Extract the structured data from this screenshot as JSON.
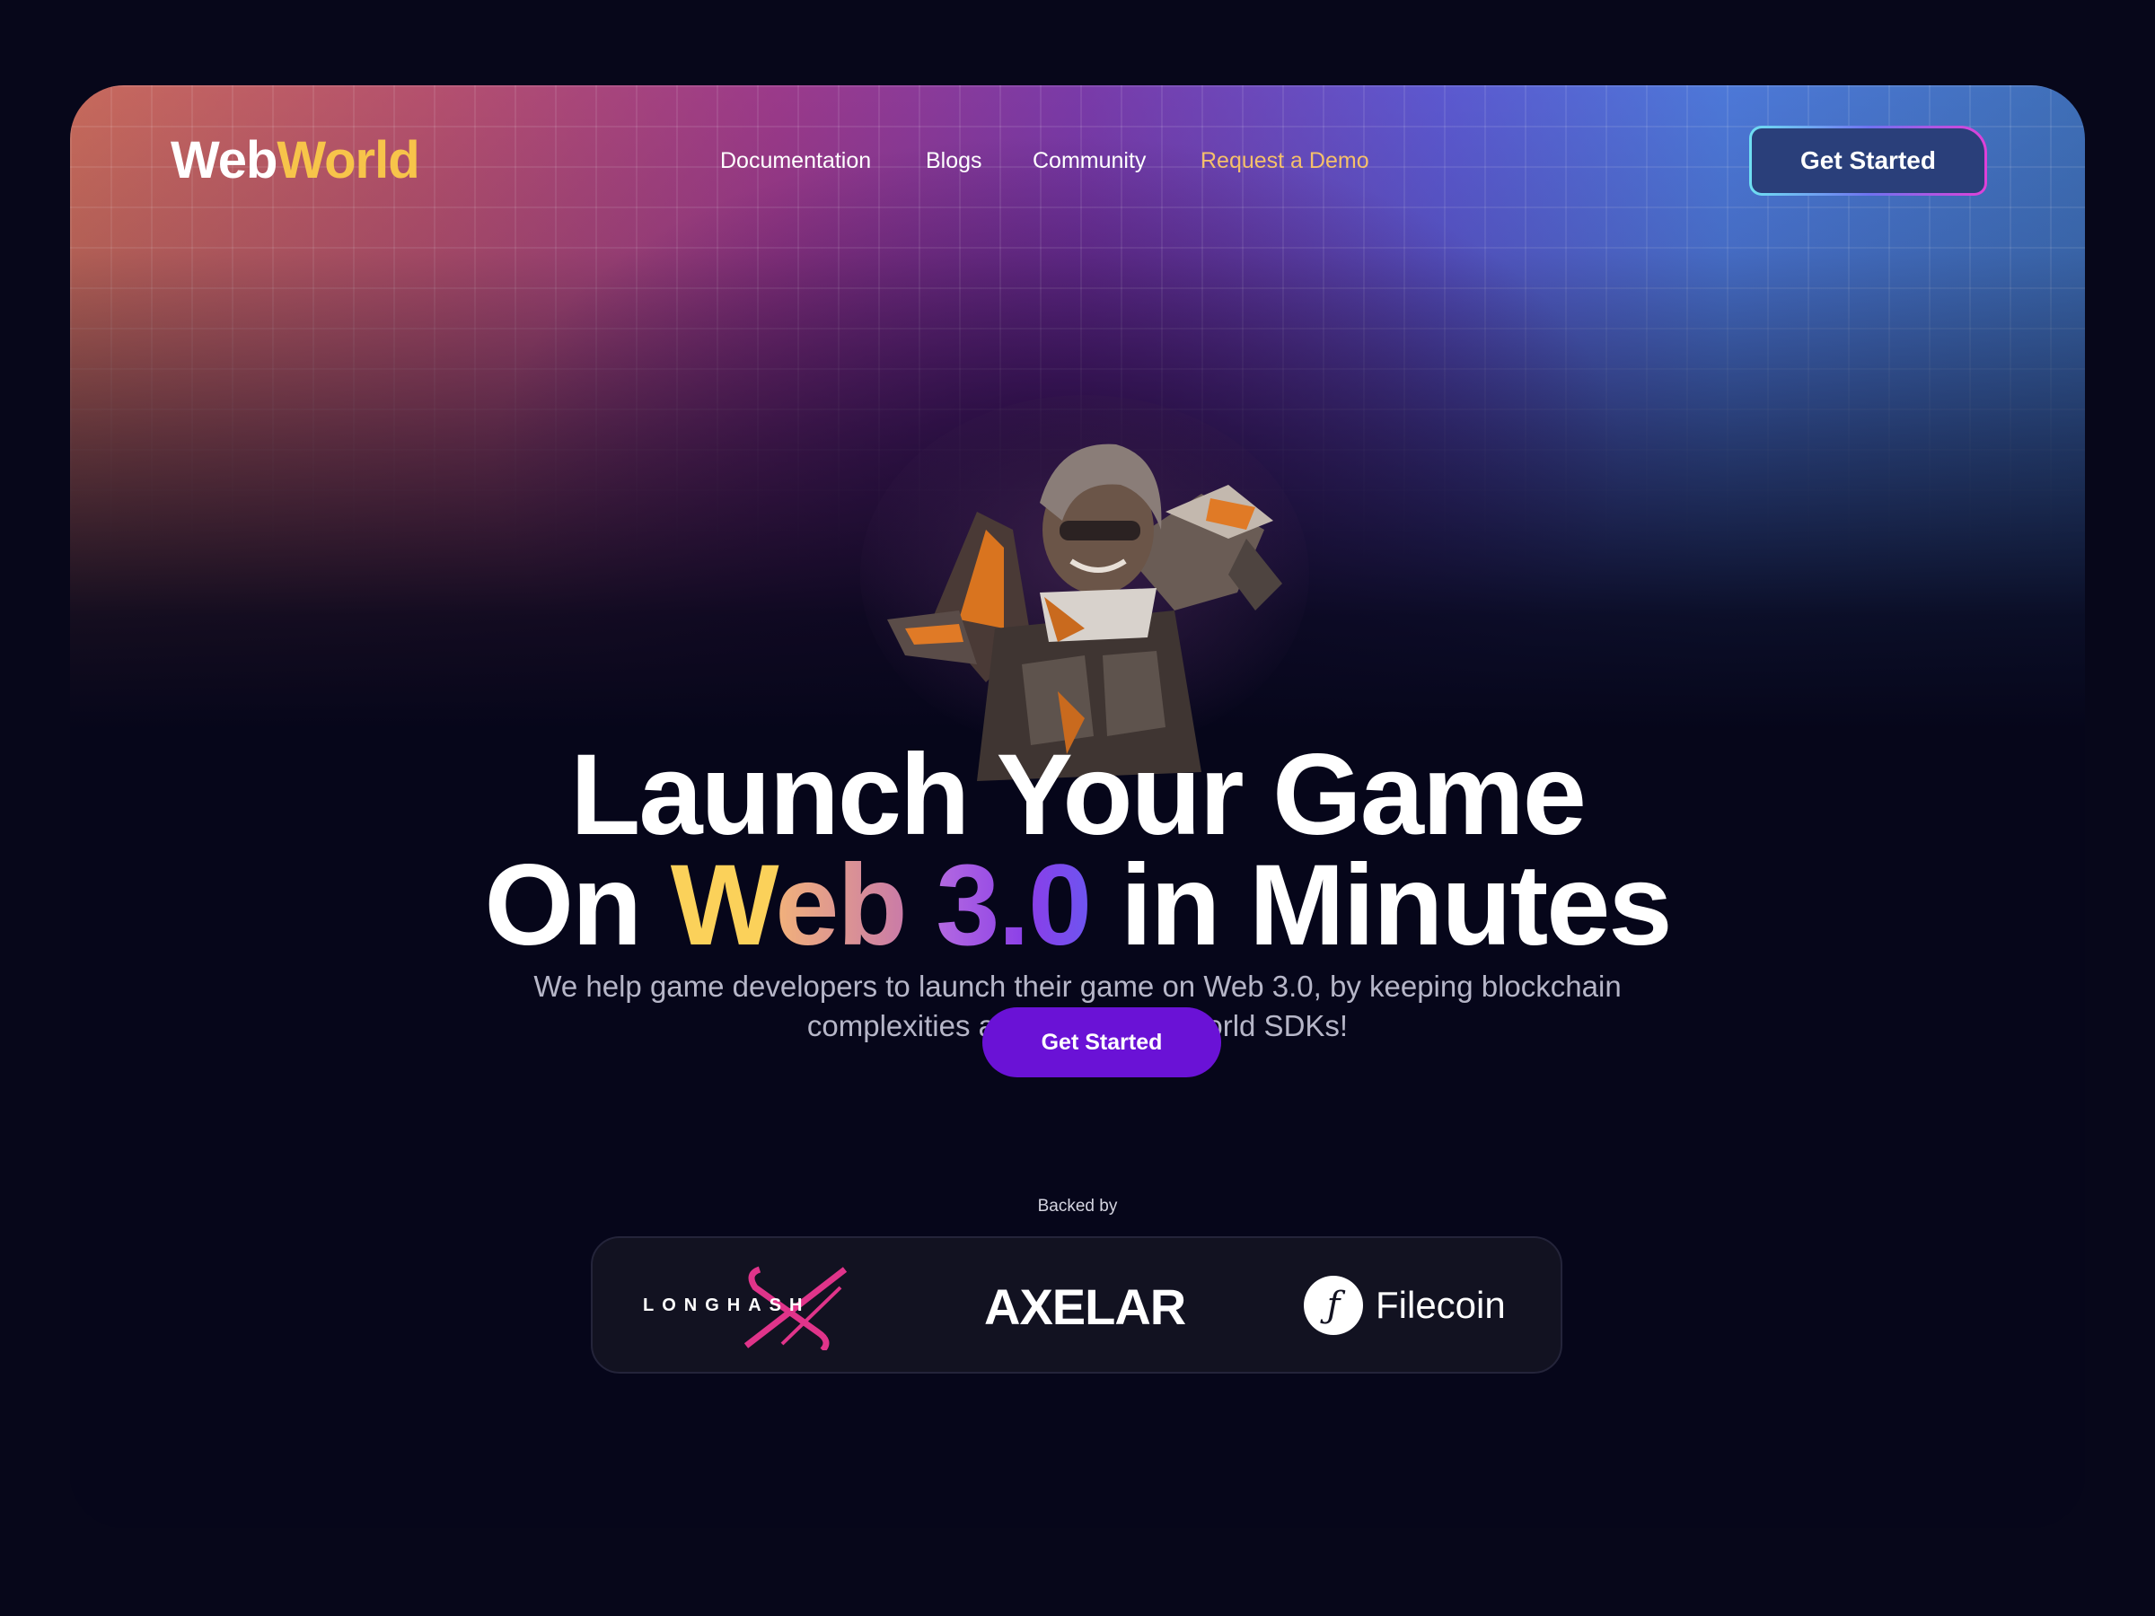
{
  "brand": {
    "name_part1": "Web",
    "name_part2": "World"
  },
  "nav": {
    "items": [
      {
        "label": "Documentation"
      },
      {
        "label": "Blogs"
      },
      {
        "label": "Community"
      },
      {
        "label": "Request a Demo"
      }
    ],
    "cta_label": "Get Started"
  },
  "hero": {
    "line1": "Launch Your Game",
    "line2_on": "On",
    "line2_w": "W",
    "line2_eb": "eb",
    "line2_30": "3.0",
    "line2_rest": "in Minutes",
    "subtext_line1": "We help game developers to launch their game on Web 3.0, by keeping blockchain",
    "subtext_line2": "complexities aside with WebWorld SDKs!",
    "cta_label": "Get Started"
  },
  "backers": {
    "label": "Backed by",
    "items": [
      {
        "name": "LONGHASH"
      },
      {
        "name": "AXELAR"
      },
      {
        "name": "Filecoin"
      }
    ]
  },
  "colors": {
    "accent_yellow": "#f7c44a",
    "accent_purple": "#6a12d6",
    "request_demo": "#f5c06a",
    "background": "#07071a",
    "longhash_pink": "#e0348a"
  }
}
